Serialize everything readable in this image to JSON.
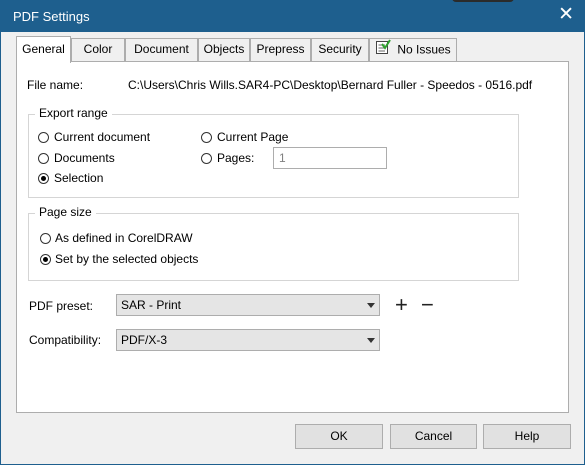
{
  "window": {
    "title": "PDF Settings",
    "close_glyph": "✕"
  },
  "tabs": [
    {
      "label": "General",
      "active": true
    },
    {
      "label": "Color"
    },
    {
      "label": "Document"
    },
    {
      "label": "Objects"
    },
    {
      "label": "Prepress"
    },
    {
      "label": "Security"
    },
    {
      "label": "No Issues",
      "icon": "checklist-icon"
    }
  ],
  "file": {
    "label": "File name:",
    "value": "C:\\Users\\Chris Wills.SAR4-PC\\Desktop\\Bernard Fuller - Speedos - 0516.pdf"
  },
  "export_range": {
    "title": "Export range",
    "options": {
      "current_document": "Current document",
      "documents": "Documents",
      "selection": "Selection",
      "current_page": "Current Page",
      "pages": "Pages:"
    },
    "selected": "selection",
    "pages_value": "1"
  },
  "page_size": {
    "title": "Page size",
    "options": {
      "as_defined": "As defined in CorelDRAW",
      "set_by_selected": "Set by the selected objects"
    },
    "selected": "set_by_selected"
  },
  "pdf_preset": {
    "label": "PDF preset:",
    "value": "SAR - Print",
    "add": "+",
    "remove": "−"
  },
  "compatibility": {
    "label": "Compatibility:",
    "value": "PDF/X-3"
  },
  "buttons": {
    "ok": "OK",
    "cancel": "Cancel",
    "help": "Help"
  },
  "colors": {
    "titlebar": "#1e5f8e",
    "dialog_bg": "#f0f0f0",
    "panel_bg": "#ffffff"
  }
}
